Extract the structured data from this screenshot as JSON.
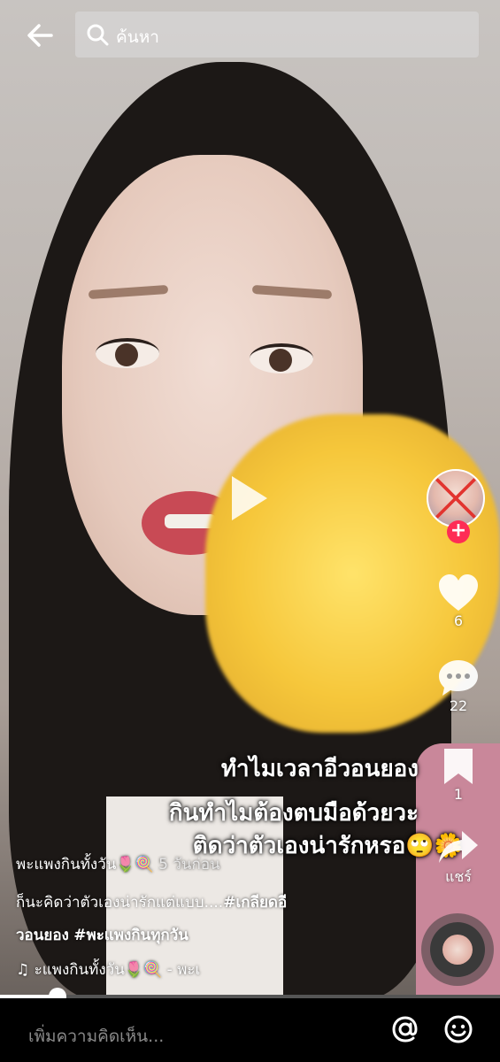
{
  "search": {
    "placeholder": "ค้นหา"
  },
  "overlay": {
    "line1": "ทำไมเวลาอีวอนยอง",
    "line2": "กินทำไมต้องตบมือด้วยวะ",
    "line3": "ติดว่าตัวเองน่ารักหรอ🙄🌼"
  },
  "actions": {
    "likes": "6",
    "comments": "22",
    "saves": "1",
    "share_label": "แชร์"
  },
  "caption": {
    "author": "พะแพงกินทั้งวัน🌷🍭",
    "time": "5 วันก่อน",
    "text_line1": "ก็นะคิดว่าตัวเองน่ารักแต่แบบ....",
    "hashtag1a": "#เกลียดอี",
    "hashtag1b": "วอนยอง",
    "hashtag2": "#พะแพงกินทุกวัน",
    "music": "♫ ะแพงกินทั้งวัน🌷🍭 - พะเ"
  },
  "progress": {
    "fraction": 0.115
  },
  "comment_bar": {
    "placeholder": "เพิ่มความคิดเห็น..."
  },
  "icons": {
    "back": "back-arrow-icon",
    "search": "search-icon",
    "like": "heart-icon",
    "comment": "comment-icon",
    "save": "bookmark-icon",
    "share": "share-icon",
    "mention": "at-icon",
    "emoji": "emoji-icon"
  },
  "colors": {
    "accent": "#fe2c55"
  }
}
